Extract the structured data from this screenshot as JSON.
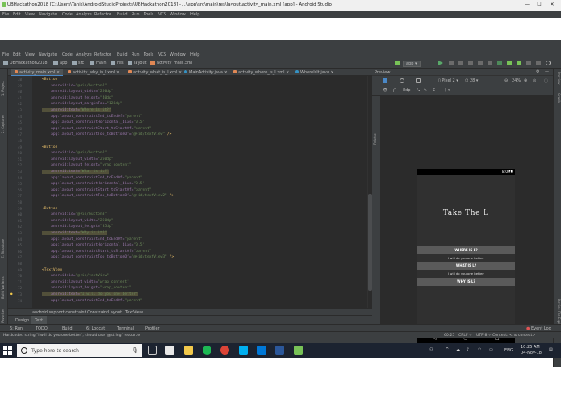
{
  "window": {
    "title": "UBHackathon2018 [C:\\Users\\Tanis\\AndroidStudioProjects\\UBHackathon2018] - ...\\app\\src\\main\\res\\layout\\activity_main.xml [app] - Android Studio",
    "minimize": "—",
    "maximize": "☐",
    "close": "✕"
  },
  "menu": [
    "File",
    "Edit",
    "View",
    "Navigate",
    "Code",
    "Analyze",
    "Refactor",
    "Build",
    "Run",
    "Tools",
    "VCS",
    "Window",
    "Help"
  ],
  "breadcrumb": [
    "UBHackathon2018",
    "app",
    "src",
    "main",
    "res",
    "layout",
    "activity_main.xml"
  ],
  "run_config": "app",
  "left_tools": [
    "1: Project",
    "2: Captures",
    "Z: Structure",
    "Build Variants",
    "2: Favorites"
  ],
  "editor_tabs": [
    "activity_main.xml",
    "activity_why_is_l.xml",
    "activity_what_is_l.xml",
    "MainActivity.java",
    "activity_where_is_l.xml",
    "WhereIsIt.java"
  ],
  "code_lines": [
    [
      {
        "c": "tag",
        "t": "<Button"
      }
    ],
    [
      {
        "c": "attr",
        "t": "    android:id="
      },
      {
        "c": "val",
        "t": "\"@+id/button2\""
      }
    ],
    [
      {
        "c": "attr",
        "t": "    android:layout_width="
      },
      {
        "c": "val",
        "t": "\"250dp\""
      }
    ],
    [
      {
        "c": "attr",
        "t": "    android:layout_height="
      },
      {
        "c": "val",
        "t": "\"40dp\""
      }
    ],
    [
      {
        "c": "attr",
        "t": "    android:layout_marginTop="
      },
      {
        "c": "val",
        "t": "\"128dp\""
      }
    ],
    [
      {
        "c": "attr hl",
        "t": "    android:text="
      },
      {
        "c": "val hl",
        "t": "\"Where is it?\""
      }
    ],
    [
      {
        "c": "attr",
        "t": "    app:layout_constraintEnd_toEndOf="
      },
      {
        "c": "val",
        "t": "\"parent\""
      }
    ],
    [
      {
        "c": "attr",
        "t": "    app:layout_constraintHorizontal_bias="
      },
      {
        "c": "val",
        "t": "\"0.5\""
      }
    ],
    [
      {
        "c": "attr",
        "t": "    app:layout_constraintStart_toStartOf="
      },
      {
        "c": "val",
        "t": "\"parent\""
      }
    ],
    [
      {
        "c": "attr",
        "t": "    app:layout_constraintTop_toBottomOf="
      },
      {
        "c": "val",
        "t": "\"@+id/textView\""
      },
      {
        "c": "tag",
        "t": " />"
      }
    ],
    [
      {
        "c": "",
        "t": ""
      }
    ],
    [
      {
        "c": "tag",
        "t": "<Button"
      }
    ],
    [
      {
        "c": "attr",
        "t": "    android:id="
      },
      {
        "c": "val",
        "t": "\"@+id/button2\""
      }
    ],
    [
      {
        "c": "attr",
        "t": "    android:layout_width="
      },
      {
        "c": "val",
        "t": "\"250dp\""
      }
    ],
    [
      {
        "c": "attr",
        "t": "    android:layout_height="
      },
      {
        "c": "val",
        "t": "\"wrap_content\""
      }
    ],
    [
      {
        "c": "attr hl",
        "t": "    android:text="
      },
      {
        "c": "val hl",
        "t": "\"What is it?\""
      }
    ],
    [
      {
        "c": "attr",
        "t": "    app:layout_constraintEnd_toEndOf="
      },
      {
        "c": "val",
        "t": "\"parent\""
      }
    ],
    [
      {
        "c": "attr",
        "t": "    app:layout_constraintHorizontal_bias="
      },
      {
        "c": "val",
        "t": "\"0.5\""
      }
    ],
    [
      {
        "c": "attr",
        "t": "    app:layout_constraintStart_toStartOf="
      },
      {
        "c": "val",
        "t": "\"parent\""
      }
    ],
    [
      {
        "c": "attr",
        "t": "    app:layout_constraintTop_toBottomOf="
      },
      {
        "c": "val",
        "t": "\"@+id/textView2\""
      },
      {
        "c": "tag",
        "t": " />"
      }
    ],
    [
      {
        "c": "",
        "t": ""
      }
    ],
    [
      {
        "c": "tag",
        "t": "<Button"
      }
    ],
    [
      {
        "c": "attr",
        "t": "    android:id="
      },
      {
        "c": "val",
        "t": "\"@+id/button3\""
      }
    ],
    [
      {
        "c": "attr",
        "t": "    android:layout_width="
      },
      {
        "c": "val",
        "t": "\"250dp\""
      }
    ],
    [
      {
        "c": "attr",
        "t": "    android:layout_height="
      },
      {
        "c": "val",
        "t": "\"35dp\""
      }
    ],
    [
      {
        "c": "attr hl",
        "t": "    android:text="
      },
      {
        "c": "val hl",
        "t": "\"Why is it?\""
      }
    ],
    [
      {
        "c": "attr",
        "t": "    app:layout_constraintEnd_toEndOf="
      },
      {
        "c": "val",
        "t": "\"parent\""
      }
    ],
    [
      {
        "c": "attr",
        "t": "    app:layout_constraintHorizontal_bias="
      },
      {
        "c": "val",
        "t": "\"0.5\""
      }
    ],
    [
      {
        "c": "attr",
        "t": "    app:layout_constraintStart_toStartOf="
      },
      {
        "c": "val",
        "t": "\"parent\""
      }
    ],
    [
      {
        "c": "attr",
        "t": "    app:layout_constraintTop_toBottomOf="
      },
      {
        "c": "val",
        "t": "\"@+id/textView3\""
      },
      {
        "c": "tag",
        "t": " />"
      }
    ],
    [
      {
        "c": "",
        "t": ""
      }
    ],
    [
      {
        "c": "tag",
        "t": "<TextView"
      }
    ],
    [
      {
        "c": "attr",
        "t": "    android:id="
      },
      {
        "c": "val",
        "t": "\"@+id/textView\""
      }
    ],
    [
      {
        "c": "attr",
        "t": "    android:layout_width="
      },
      {
        "c": "val",
        "t": "\"wrap_content\""
      }
    ],
    [
      {
        "c": "attr",
        "t": "    android:layout_height="
      },
      {
        "c": "val",
        "t": "\"wrap_content\""
      }
    ],
    [
      {
        "c": "attr hl",
        "t": "    android:text="
      },
      {
        "c": "val hl",
        "t": "\"I will do you one better\""
      }
    ],
    [
      {
        "c": "attr",
        "t": "    app:layout_constraintEnd_toEndOf="
      },
      {
        "c": "val",
        "t": "\"parent\""
      }
    ]
  ],
  "editor_breadcrumb": [
    "android.support.constraint.ConstraintLayout",
    "TextView"
  ],
  "design_tabs": [
    "Design",
    "Text"
  ],
  "preview": {
    "header": "Preview",
    "device": "Pixel 2",
    "api": "28",
    "zoom": "24%",
    "palette_label": "Palette",
    "status_time": "8:00",
    "app_title": "Take The L",
    "buttons": [
      "WHERE IS L?",
      "WHAT IS L?",
      "WHY IS L?"
    ],
    "subtext": "I will do you one better"
  },
  "right_tools": [
    "Preview",
    "Gradle",
    "Device File Explorer"
  ],
  "bottom_tools": [
    "6: Run",
    "TODO",
    "Build",
    "6: Logcat",
    "Terminal",
    "Profiler"
  ],
  "event_log": "Event Log",
  "status_message": "Hardcoded string \"I will do you one better\", should use '@string' resource",
  "status_right": [
    "60:25",
    "CRLF ÷",
    "UTF-8 ÷",
    "Context: <no context>"
  ],
  "taskbar": {
    "search_placeholder": "Type here to search",
    "time": "10:25 AM",
    "date": "04-Nov-18",
    "lang": "ENG"
  },
  "colors": {
    "ide_bg": "#3c3f41",
    "editor_bg": "#2b2b2b",
    "accent": "#4a88c7",
    "android_green": "#78c257"
  }
}
